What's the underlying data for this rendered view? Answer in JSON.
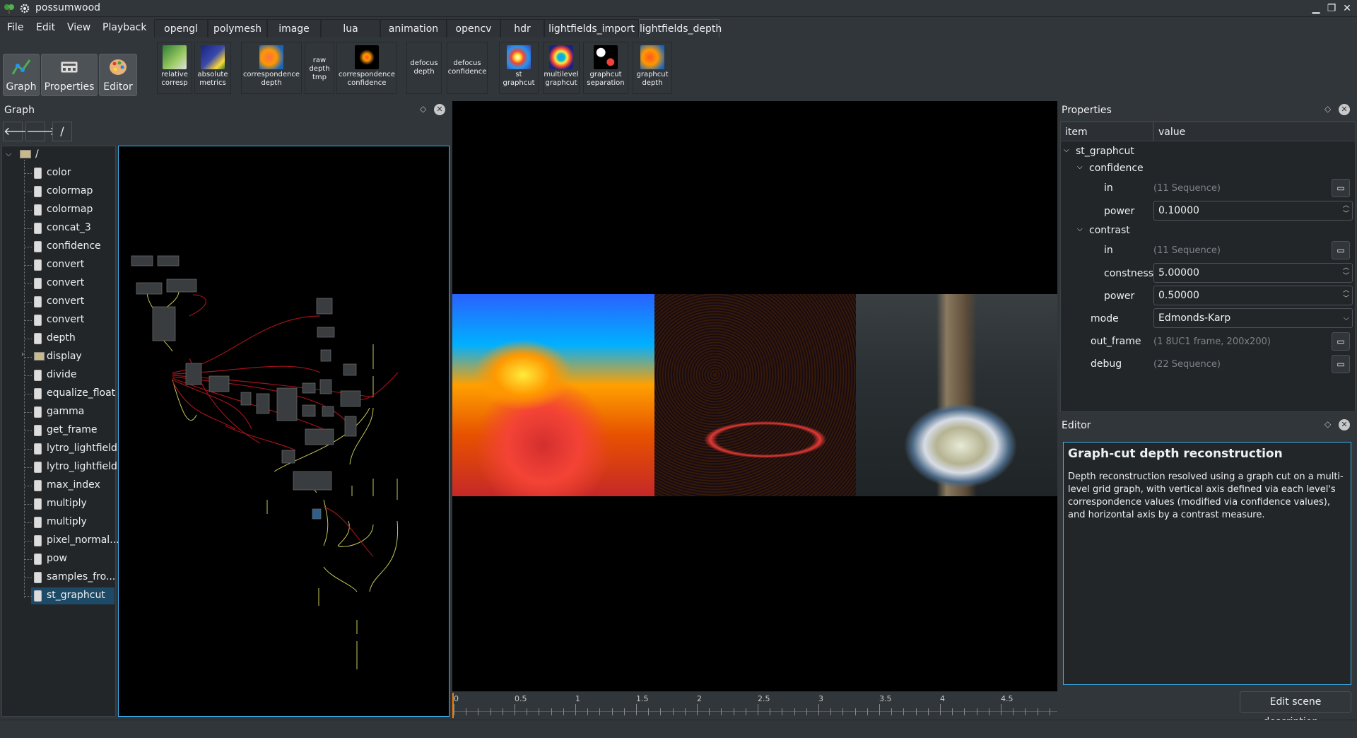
{
  "app": {
    "title": "possumwood"
  },
  "window_buttons": {
    "minimize": "▁",
    "maximize": "❐",
    "close": "✕"
  },
  "menu": [
    "File",
    "Edit",
    "View",
    "Playback"
  ],
  "tabs": [
    "opengl",
    "polymesh",
    "image",
    "lua",
    "animation",
    "opencv",
    "hdr",
    "lightfields_import",
    "lightfields_depth"
  ],
  "active_tab": "lightfields_depth",
  "tools": [
    {
      "lines": [
        "relative",
        "corresp"
      ],
      "icon": "relative-corresp-icon"
    },
    {
      "lines": [
        "absolute",
        "metrics"
      ],
      "icon": "absolute-metrics-icon"
    },
    {
      "lines": [
        "correspondence",
        "depth"
      ],
      "icon": "correspondence-depth-icon"
    },
    {
      "lines": [
        "raw",
        "depth",
        "tmp"
      ],
      "icon": ""
    },
    {
      "lines": [
        "correspondence",
        "confidence"
      ],
      "icon": "correspondence-confidence-icon"
    },
    {
      "lines": [
        "defocus",
        "depth"
      ],
      "icon": ""
    },
    {
      "lines": [
        "defocus",
        "confidence"
      ],
      "icon": ""
    },
    {
      "lines": [
        "st",
        "graphcut"
      ],
      "icon": "st-graphcut-icon"
    },
    {
      "lines": [
        "multilevel",
        "graphcut"
      ],
      "icon": "multilevel-graphcut-icon"
    },
    {
      "lines": [
        "graphcut",
        "separation"
      ],
      "icon": "graphcut-separation-icon"
    },
    {
      "lines": [
        "graphcut",
        "depth"
      ],
      "icon": "graphcut-depth-icon"
    }
  ],
  "modes": [
    "Graph",
    "Properties",
    "Editor"
  ],
  "graph_panel": {
    "title": "Graph",
    "path": "/",
    "back": "🡐",
    "forward": "🡒"
  },
  "tree": {
    "root": "/",
    "items": [
      "color",
      "colormap",
      "colormap",
      "concat_3",
      "confidence",
      "convert",
      "convert",
      "convert",
      "convert",
      "depth",
      "display",
      "divide",
      "equalize_float",
      "gamma",
      "get_frame",
      "lytro_lightfield",
      "lytro_lightfield",
      "max_index",
      "multiply",
      "multiply",
      "pixel_normal...",
      "pow",
      "samples_fro...",
      "st_graphcut"
    ],
    "selected": "st_graphcut"
  },
  "timeline": {
    "ticks": [
      "0",
      "0.5",
      "1",
      "1.5",
      "2",
      "2.5",
      "3",
      "3.5",
      "4",
      "4.5"
    ]
  },
  "properties": {
    "title": "Properties",
    "col_item": "item",
    "col_value": "value",
    "node": "st_graphcut",
    "confidence": {
      "label": "confidence",
      "in_label": "in",
      "in_value": "(11 Sequence)",
      "power_label": "power",
      "power_value": "0.10000"
    },
    "contrast": {
      "label": "contrast",
      "in_label": "in",
      "in_value": "(11 Sequence)",
      "constness_label": "constness",
      "constness_value": "5.00000",
      "power_label": "power",
      "power_value": "0.50000"
    },
    "mode_label": "mode",
    "mode_value": "Edmonds-Karp",
    "out_frame_label": "out_frame",
    "out_frame_value": "(1 8UC1 frame, 200x200)",
    "debug_label": "debug",
    "debug_value": "(22 Sequence)"
  },
  "editor": {
    "title": "Editor",
    "heading": "Graph-cut depth reconstruction",
    "body": "Depth reconstruction resolved using a graph cut on a multi-level grid graph, with vertical axis defined via each level's correspondence values (modified via confidence values), and horizontal axis by a contrast measure.",
    "button": "Edit scene description..."
  },
  "accent": "#3daee9"
}
